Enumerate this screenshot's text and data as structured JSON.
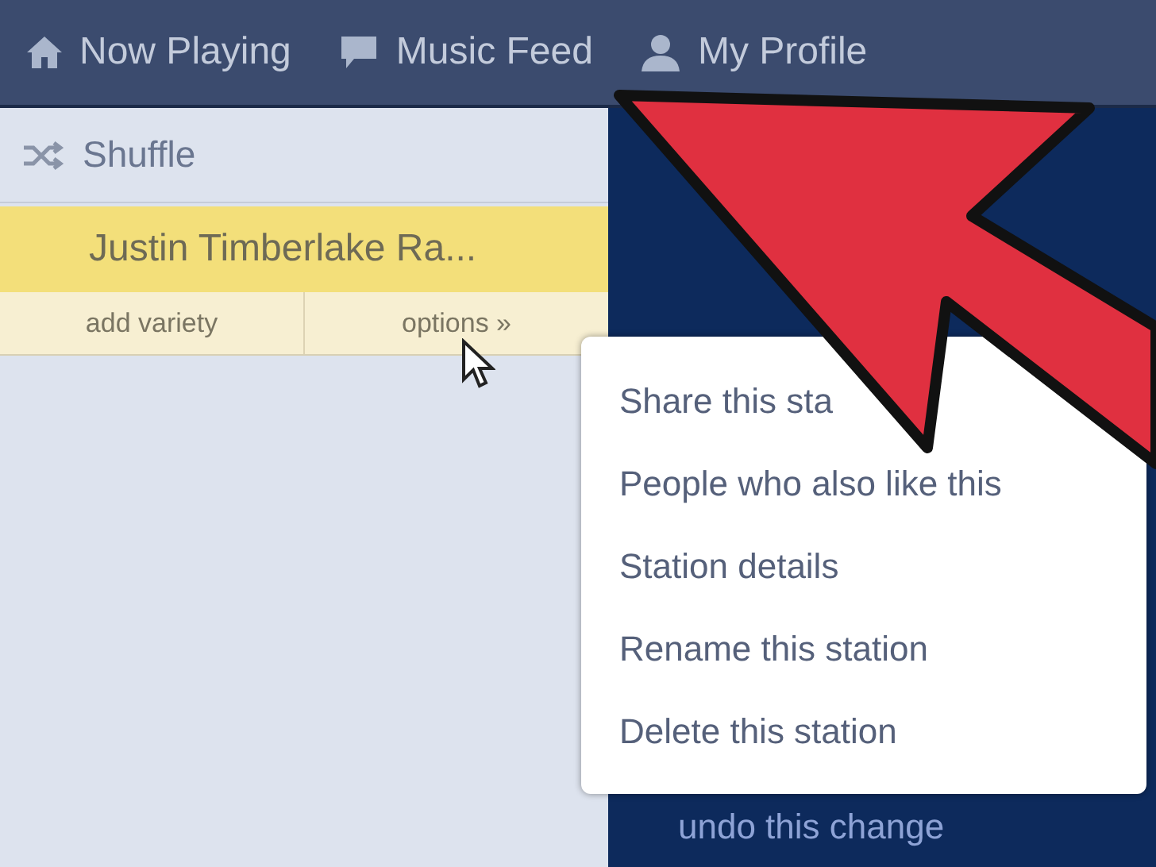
{
  "nav": [
    {
      "label": "Now Playing",
      "kind": "home"
    },
    {
      "label": "Music Feed",
      "kind": "feed"
    },
    {
      "label": "My Profile",
      "kind": "profile"
    }
  ],
  "shuffle": {
    "label": "Shuffle"
  },
  "station": {
    "name": "Justin Timberlake Ra...",
    "selected": true,
    "actions": [
      "add variety",
      "options »"
    ]
  },
  "menu": [
    "Share this sta",
    "People who also like this",
    "Station details",
    "Rename this station",
    "Delete this station"
  ],
  "undo": "undo this change"
}
